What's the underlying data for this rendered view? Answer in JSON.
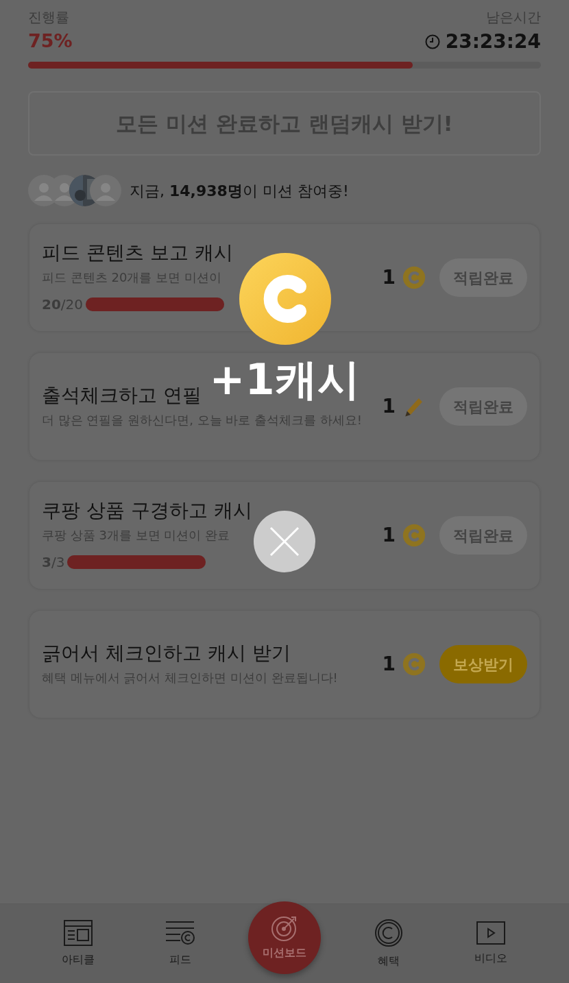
{
  "progress": {
    "label": "진행률",
    "value": "75%",
    "level": 0.75
  },
  "timer": {
    "label": "남은시간",
    "value": "23:23:24"
  },
  "banner": {
    "text": "모든 미션 완료하고 랜덤캐시 받기!"
  },
  "participants": {
    "avatars": [
      {
        "kind": "silhouette"
      },
      {
        "kind": "silhouette"
      },
      {
        "kind": "picture"
      },
      {
        "kind": "silhouette"
      }
    ],
    "text": "지금, **14,938명**이 미션 참여중!"
  },
  "missions": [
    {
      "title": "피드 콘텐츠 보고 캐시",
      "description": "피드 콘텐츠 20개를 보면 미션이",
      "count": "**20**/20",
      "level": 1,
      "reward": {
        "amount": "1",
        "kind": "coin"
      },
      "button": {
        "label": "적립완료",
        "kind": "done"
      }
    },
    {
      "title": "출석체크하고 연필",
      "description": "더 많은 연필을 원하신다면, 오늘 바로 출석체크를 하세요!",
      "reward": {
        "amount": "1",
        "kind": "pencil"
      },
      "button": {
        "label": "적립완료",
        "kind": "done"
      }
    },
    {
      "title": "쿠팡 상품 구경하고 캐시",
      "description": "쿠팡 상품 3개를 보면 미션이 완료",
      "count": "**3**/3",
      "level": 1,
      "reward": {
        "amount": "1",
        "kind": "coin"
      },
      "button": {
        "label": "적립완료",
        "kind": "done"
      }
    },
    {
      "title": "긁어서 체크인하고 캐시 받기",
      "description": "혜택 메뉴에서 긁어서 체크인하면 미션이 완료됩니다!",
      "reward": {
        "amount": "1",
        "kind": "coin"
      },
      "button": {
        "label": "보상받기",
        "kind": "claim"
      }
    }
  ],
  "popup": {
    "text": "+1캐시"
  },
  "nav": [
    {
      "label": "아티클",
      "kind": "article",
      "selected": false
    },
    {
      "label": "피드",
      "kind": "feed",
      "selected": false
    },
    {
      "label": "미션보드",
      "kind": "target",
      "selected": true
    },
    {
      "label": "혜택",
      "kind": "benefit",
      "selected": false
    },
    {
      "label": "비디오",
      "kind": "video",
      "selected": false
    }
  ]
}
